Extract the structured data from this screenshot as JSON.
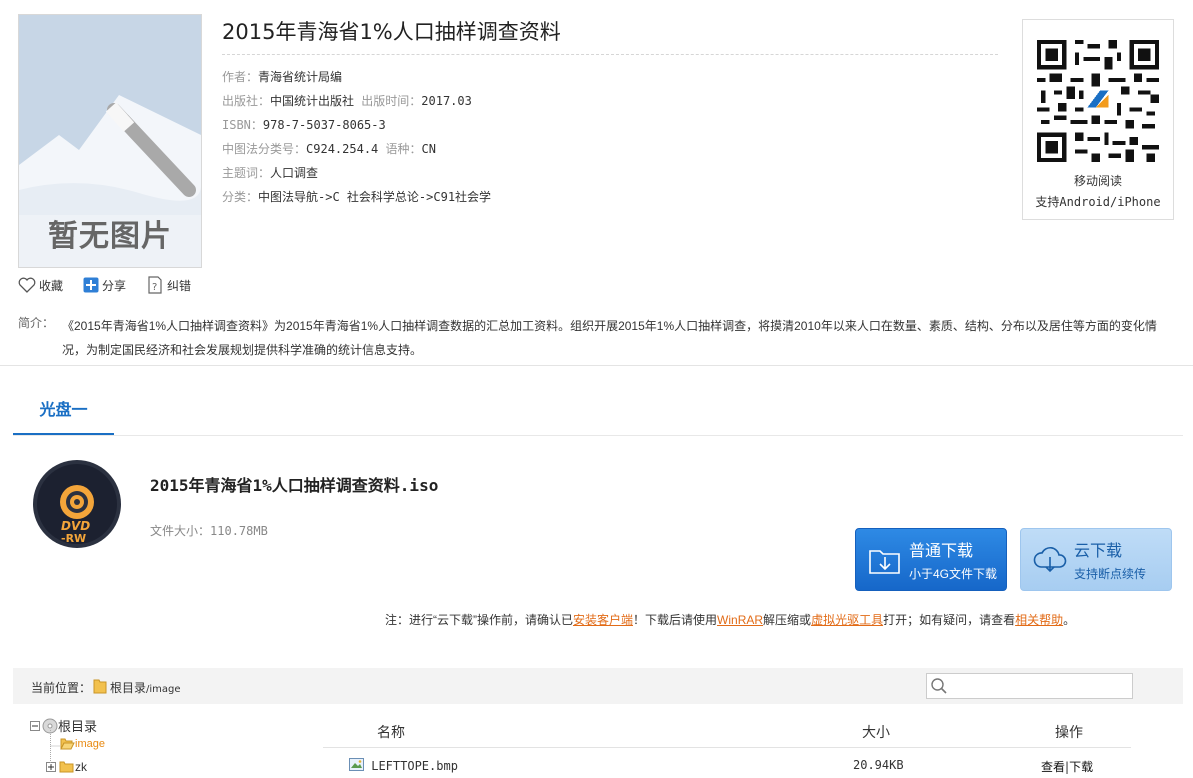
{
  "cover": {
    "placeholder_text": "暂无图片"
  },
  "book": {
    "title": "2015年青海省1%人口抽样调查资料",
    "author_k": "作者：",
    "author_v": "青海省统计局编",
    "publisher_k": "出版社：",
    "publisher_v": "中国统计出版社",
    "pubdate_k": "出版时间：",
    "pubdate_v": "2017.03",
    "isbn_k": "ISBN：",
    "isbn_v": "978-7-5037-8065-3",
    "clc_k": "中图法分类号：",
    "clc_v": "C924.254.4",
    "lang_k": "语种：",
    "lang_v": "CN",
    "subject_k": "主题词：",
    "subject_v": "人口调查",
    "category_k": "分类：",
    "category_v": "中图法导航->C 社会科学总论->C91社会学"
  },
  "qr": {
    "line1": "移动阅读",
    "line2": "支持Android/iPhone"
  },
  "actions": {
    "favorite": "收藏",
    "share": "分享",
    "report": "纠错"
  },
  "intro": {
    "label": "简介：",
    "text": "《2015年青海省1%人口抽样调查资料》为2015年青海省1%人口抽样调查数据的汇总加工资料。组织开展2015年1%人口抽样调查，将摸清2010年以来人口在数量、素质、结构、分布以及居住等方面的变化情况，为制定国民经济和社会发展规划提供科学准确的统计信息支持。"
  },
  "tab": {
    "label": "光盘一"
  },
  "disc_file": {
    "name": "2015年青海省1%人口抽样调查资料.iso",
    "size_label": "文件大小：",
    "size_value": "110.78MB"
  },
  "buttons": {
    "normal_title": "普通下载",
    "normal_sub": "小于4G文件下载",
    "cloud_title": "云下载",
    "cloud_sub": "支持断点续传"
  },
  "note": {
    "p1": "注：进行“云下载”操作前，请确认已",
    "l1": "安装客户端",
    "p2": "！下载后请使用",
    "l2": "WinRAR",
    "p3": "解压缩或",
    "l3": "虚拟光驱工具",
    "p4": "打开；如有疑问，请查看",
    "l4": "相关帮助",
    "p5": "。"
  },
  "path": {
    "label": "当前位置：",
    "root": "根目录",
    "sub": "/image"
  },
  "tree": {
    "root": "根目录",
    "image": "image",
    "zk": "zk"
  },
  "table": {
    "headers": {
      "name": "名称",
      "size": "大小",
      "ops": "操作"
    },
    "rows": [
      {
        "name": "LEFTTOPE.bmp",
        "size": "20.94KB",
        "view": "查看",
        "sep": "|",
        "download": "下载"
      }
    ]
  },
  "colors": {
    "accent": "#1a6fc4",
    "link": "#e26b17",
    "btn_primary": "#1e78d8",
    "btn_cloud": "#b3d4f4"
  }
}
